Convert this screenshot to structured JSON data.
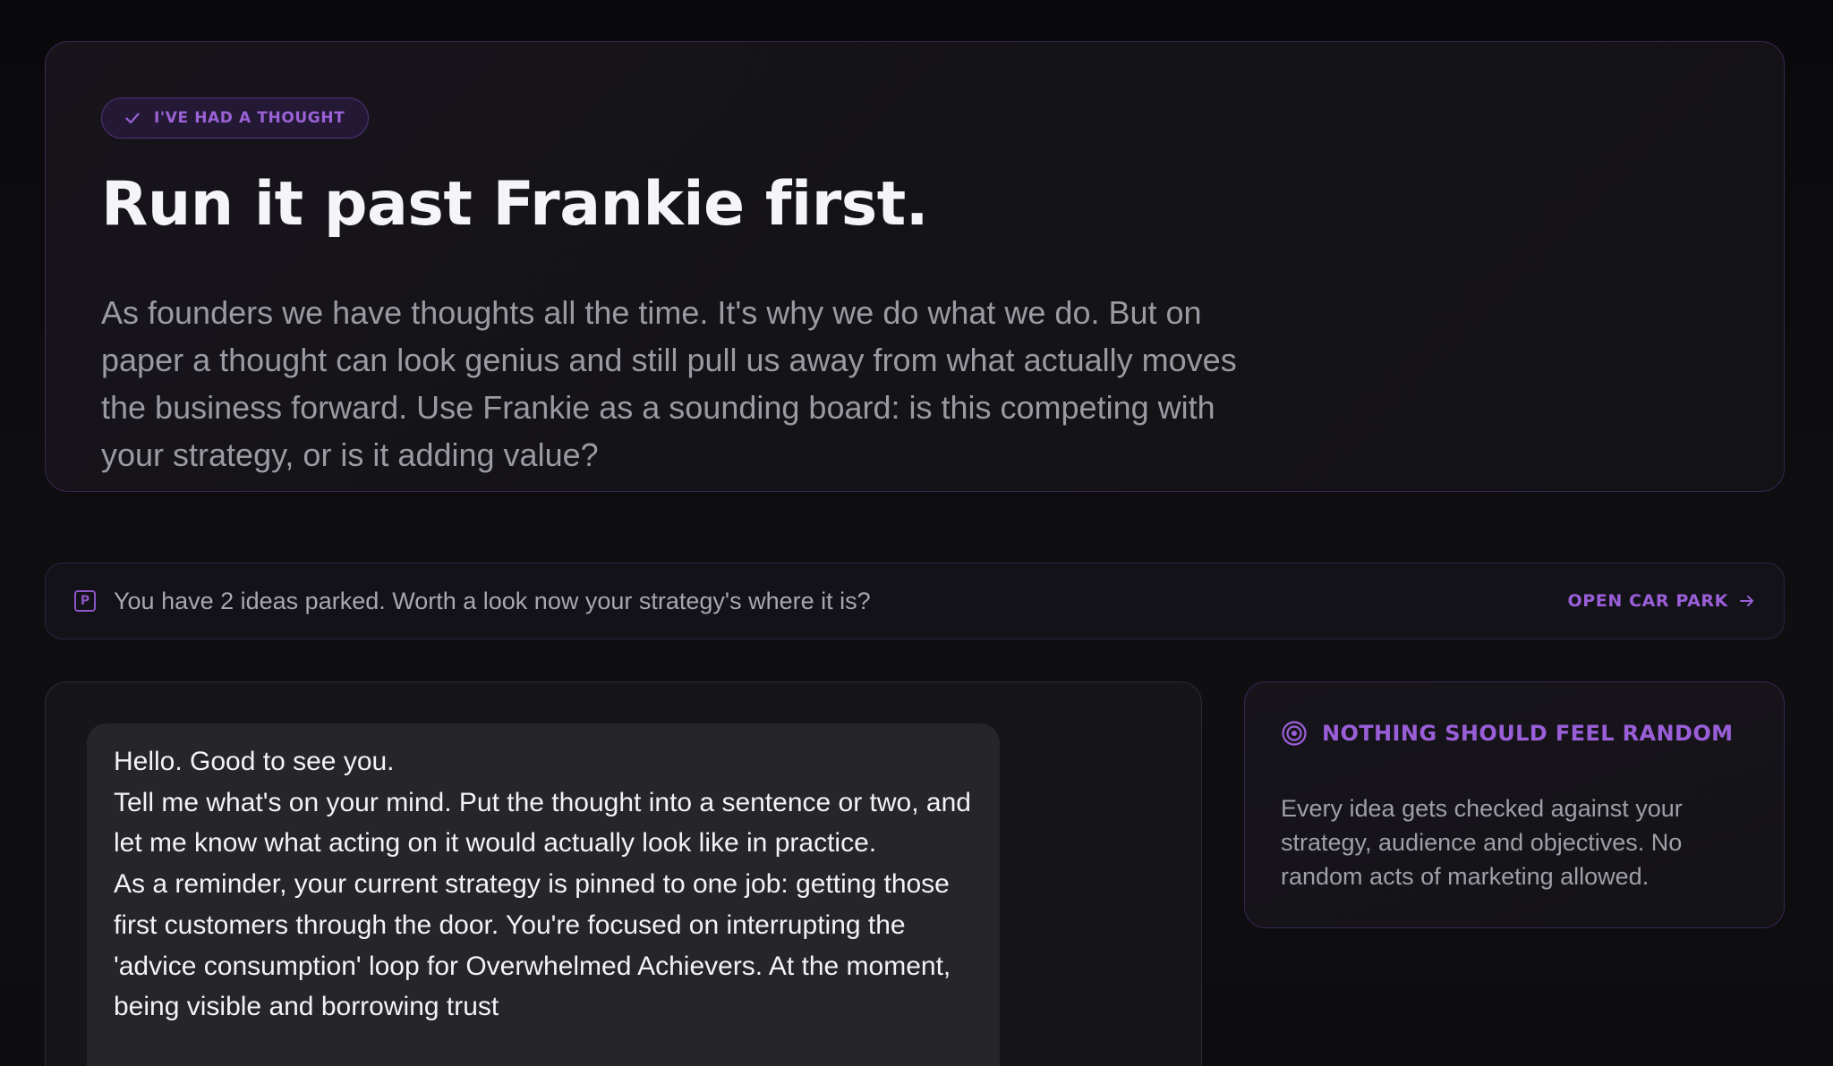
{
  "colors": {
    "accent": "#9a5fd8",
    "background": "#0c0c0e",
    "card_border": "#3a2452"
  },
  "hero": {
    "badge": {
      "icon": "check-icon",
      "label": "I'VE HAD A THOUGHT"
    },
    "title": "Run it past Frankie first.",
    "body": "As founders we have thoughts all the time. It's why we do what we do. But on paper a thought can look genius and still pull us away from what actually moves the business forward. Use Frankie as a sounding board: is this competing with your strategy, or is it adding value?"
  },
  "banner": {
    "icon": "parking-icon",
    "icon_glyph": "P",
    "text": "You have 2 ideas parked. Worth a look now your strategy's where it is?",
    "link_label": "OPEN CAR PARK",
    "link_icon": "arrow-right-icon"
  },
  "chat": {
    "message": {
      "lines": [
        "Hello. Good to see you.",
        "Tell me what's on your mind. Put the thought into a sentence or two, and let me know what acting on it would actually look like in practice.",
        "As a reminder, your current strategy is pinned to one job: getting those first customers through the door. You're focused on interrupting the 'advice consumption' loop for Overwhelmed Achievers. At the moment, being visible and borrowing trust"
      ]
    }
  },
  "info_card": {
    "icon": "target-icon",
    "title": "NOTHING SHOULD FEEL RANDOM",
    "body": "Every idea gets checked against your strategy, audience and objectives. No random acts of marketing allowed."
  }
}
